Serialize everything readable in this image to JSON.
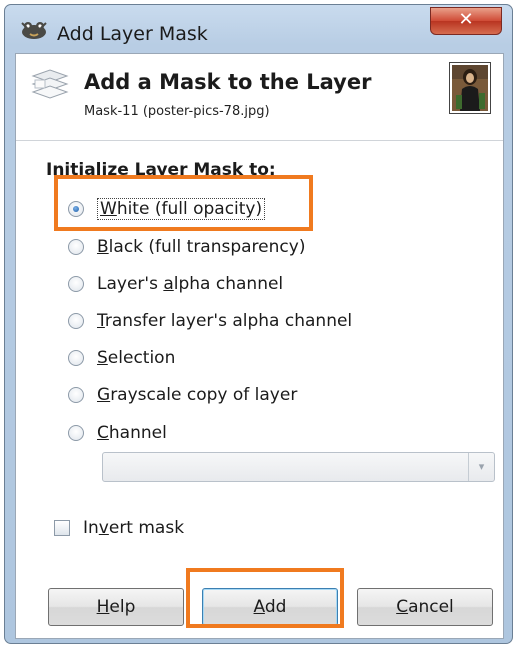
{
  "window": {
    "title": "Add Layer Mask",
    "close_glyph": "✕"
  },
  "header": {
    "title": "Add a Mask to the Layer",
    "subtitle": "Mask-11 (poster-pics-78.jpg)"
  },
  "section_label": "Initialize Layer Mask to:",
  "options": [
    {
      "pre": "",
      "mn": "W",
      "post": "hite (full opacity)",
      "checked": true
    },
    {
      "pre": "",
      "mn": "B",
      "post": "lack (full transparency)",
      "checked": false
    },
    {
      "pre": "Layer's ",
      "mn": "a",
      "post": "lpha channel",
      "checked": false
    },
    {
      "pre": "",
      "mn": "T",
      "post": "ransfer layer's alpha channel",
      "checked": false
    },
    {
      "pre": "",
      "mn": "S",
      "post": "election",
      "checked": false
    },
    {
      "pre": "",
      "mn": "G",
      "post": "rayscale copy of layer",
      "checked": false
    },
    {
      "pre": "",
      "mn": "C",
      "post": "hannel",
      "checked": false
    }
  ],
  "channel_combo": {
    "value": "",
    "arrow": "▾"
  },
  "invert": {
    "pre": "In",
    "mn": "v",
    "post": "ert mask",
    "checked": false
  },
  "buttons": {
    "help": {
      "pre": "",
      "mn": "H",
      "post": "elp"
    },
    "add": {
      "pre": "",
      "mn": "A",
      "post": "dd"
    },
    "cancel": {
      "pre": "",
      "mn": "C",
      "post": "ancel"
    }
  },
  "colors": {
    "highlight": "#f07a1f",
    "radio_dot": "#1f5fa8"
  },
  "icons": {
    "app": "gimp-wilber-icon",
    "header": "layer-mask-icon",
    "thumbnail": "layer-thumbnail"
  }
}
